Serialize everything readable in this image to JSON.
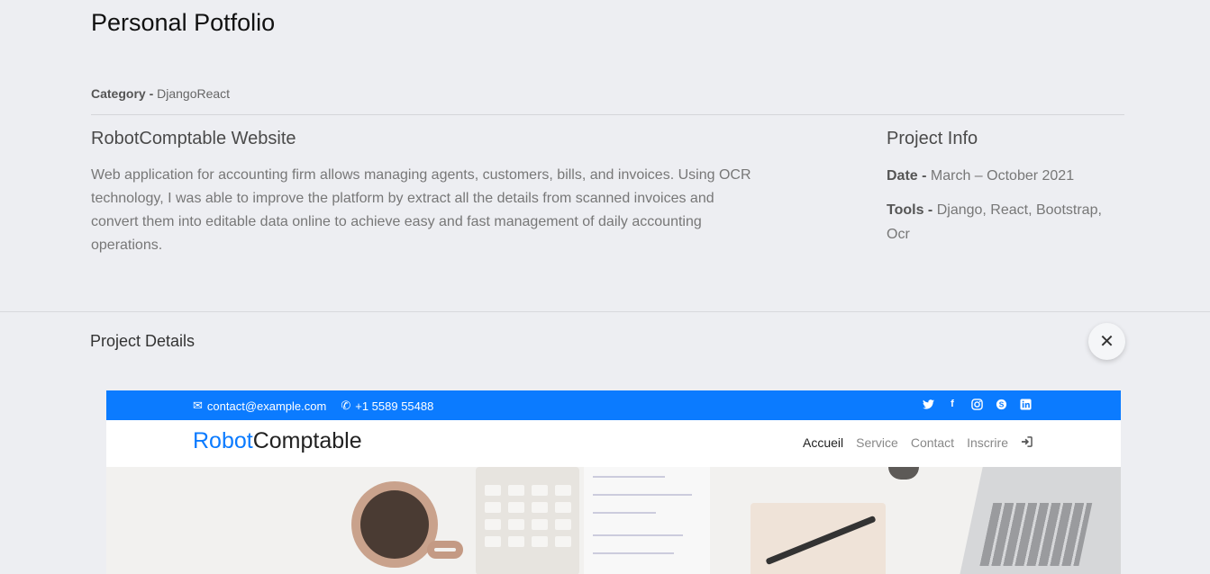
{
  "page": {
    "title": "Personal Potfolio",
    "category_label": "Category -",
    "category_value": "DjangoReact"
  },
  "project": {
    "title": "RobotComptable Website",
    "description": "Web application for accounting firm allows managing agents, customers, bills, and invoices. Using OCR technology, I was able to improve the platform by extract all the details from scanned invoices and convert them into editable data online to achieve easy and fast management of daily accounting operations."
  },
  "info": {
    "title": "Project Info",
    "date_label": "Date -",
    "date_value": "March – October 2021",
    "tools_label": "Tools -",
    "tools_value": "Django, React, Bootstrap, Ocr"
  },
  "details": {
    "title": "Project Details",
    "close_icon": "close-icon",
    "close_glyph": "✕"
  },
  "preview": {
    "email": "contact@example.com",
    "phone": "+1 5589 55488",
    "brand_accent": "Robot",
    "brand_rest": "Comptable",
    "nav": [
      "Accueil",
      "Service",
      "Contact",
      "Inscrire"
    ],
    "social_icons": [
      "twitter-icon",
      "facebook-icon",
      "instagram-icon",
      "skype-icon",
      "linkedin-icon"
    ],
    "accent_color": "#0b7bff"
  }
}
